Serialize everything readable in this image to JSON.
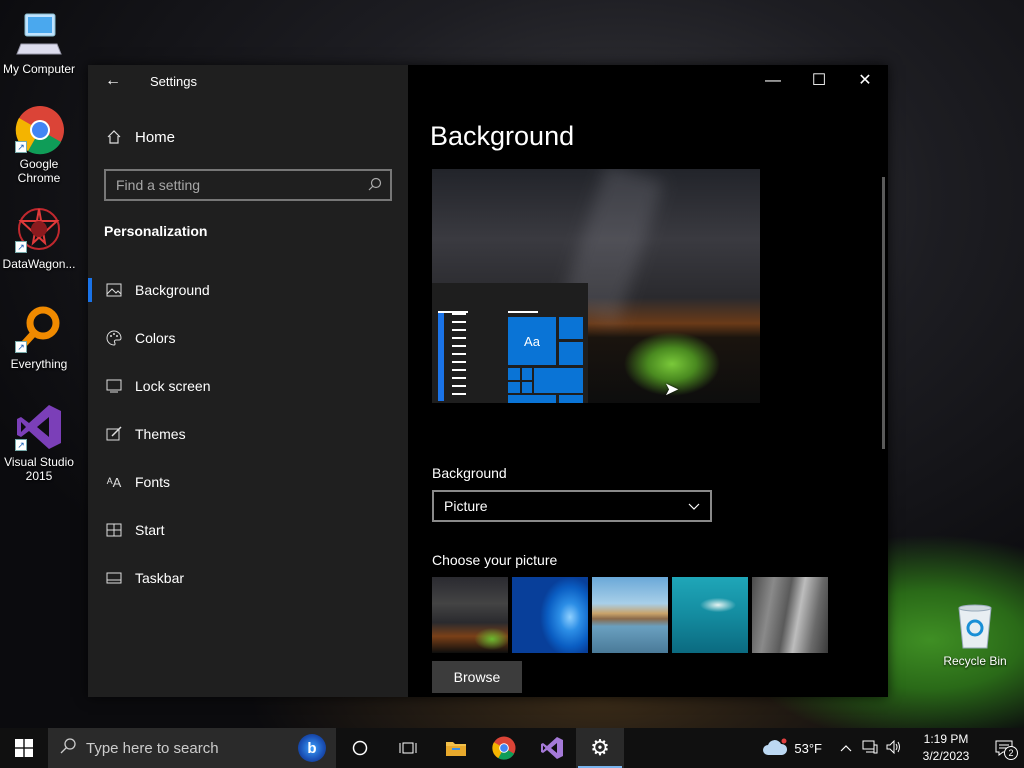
{
  "desktop": {
    "icons": [
      {
        "label": "My Computer",
        "icon": "computer-icon"
      },
      {
        "label": "Google Chrome",
        "icon": "chrome-icon"
      },
      {
        "label": "DataWagon...",
        "icon": "datawagon-icon"
      },
      {
        "label": "Everything",
        "icon": "everything-search-icon"
      },
      {
        "label": "Visual Studio 2015",
        "icon": "visual-studio-icon"
      },
      {
        "label": "Recycle Bin",
        "icon": "recycle-bin-icon"
      }
    ]
  },
  "window": {
    "title": "Settings",
    "controls": {
      "minimize": "—",
      "maximize": "☐",
      "close": "✕"
    }
  },
  "nav": {
    "home_label": "Home",
    "search_placeholder": "Find a setting",
    "section_title": "Personalization",
    "items": [
      {
        "label": "Background",
        "icon": "picture-icon",
        "active": true
      },
      {
        "label": "Colors",
        "icon": "palette-icon"
      },
      {
        "label": "Lock screen",
        "icon": "lock-screen-icon"
      },
      {
        "label": "Themes",
        "icon": "themes-brush-icon"
      },
      {
        "label": "Fonts",
        "icon": "fonts-icon"
      },
      {
        "label": "Start",
        "icon": "start-icon"
      },
      {
        "label": "Taskbar",
        "icon": "taskbar-icon"
      }
    ]
  },
  "main": {
    "page_title": "Background",
    "preview_tile_text": "Aa",
    "background_label": "Background",
    "background_value": "Picture",
    "choose_label": "Choose your picture",
    "browse_label": "Browse"
  },
  "taskbar": {
    "search_placeholder": "Type here to search",
    "weather": "53°F",
    "time": "1:19 PM",
    "date": "3/2/2023",
    "notification_count": "2"
  },
  "colors": {
    "accent": "#1a73e8",
    "tile_blue": "#0a74d6",
    "nav_bg": "#1f1f1f",
    "main_bg": "#000000"
  }
}
